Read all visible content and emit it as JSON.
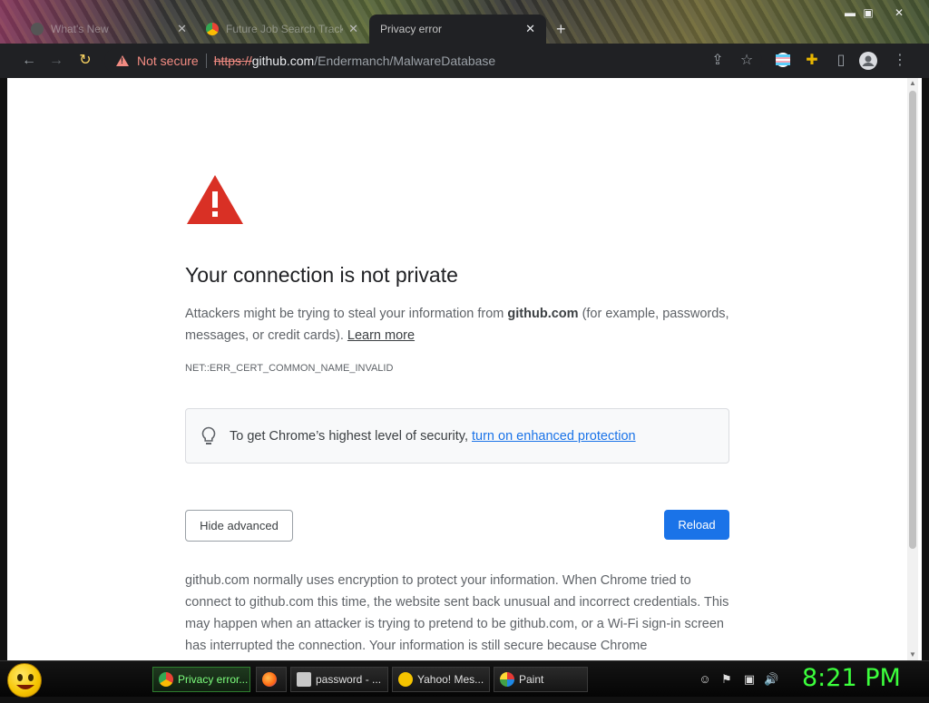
{
  "browser": {
    "tabs": [
      {
        "title": "What's New",
        "active": false
      },
      {
        "title": "Future Job Search Tracker",
        "active": false
      },
      {
        "title": "Privacy error",
        "active": true
      }
    ],
    "security_label": "Not secure",
    "url": {
      "scheme": "https://",
      "host": "github.com",
      "path": "/Endermanch/MalwareDatabase"
    }
  },
  "page": {
    "heading": "Your connection is not private",
    "explanation_prefix": "Attackers might be trying to steal your information from ",
    "explanation_host": "github.com",
    "explanation_suffix": " (for example, passwords, messages, or credit cards). ",
    "learn_more": "Learn more",
    "error_code": "NET::ERR_CERT_COMMON_NAME_INVALID",
    "enhanced_text": "To get Chrome’s highest level of security,",
    "enhanced_link": "turn on enhanced protection",
    "hide_advanced_label": "Hide advanced",
    "reload_label": "Reload",
    "details": "github.com normally uses encryption to protect your information. When Chrome tried to connect to github.com this time, the website sent back unusual and incorrect credentials. This may happen when an attacker is trying to pretend to be github.com, or a Wi-Fi sign-in screen has interrupted the connection. Your information is still secure because Chrome"
  },
  "taskbar": {
    "items": [
      {
        "label": "Privacy error...",
        "icon": "chrome-icon",
        "active": true
      },
      {
        "label": "",
        "icon": "firefox-icon",
        "active": false
      },
      {
        "label": "password - ...",
        "icon": "notepad-icon",
        "active": false
      },
      {
        "label": "Yahoo! Mes...",
        "icon": "yahoo-messenger-icon",
        "active": false
      },
      {
        "label": "Paint",
        "icon": "paint-icon",
        "active": false
      }
    ],
    "clock": "8:21 PM"
  },
  "colors": {
    "accent": "#1a73e8",
    "danger": "#d93025",
    "clock": "#3cff3c"
  }
}
